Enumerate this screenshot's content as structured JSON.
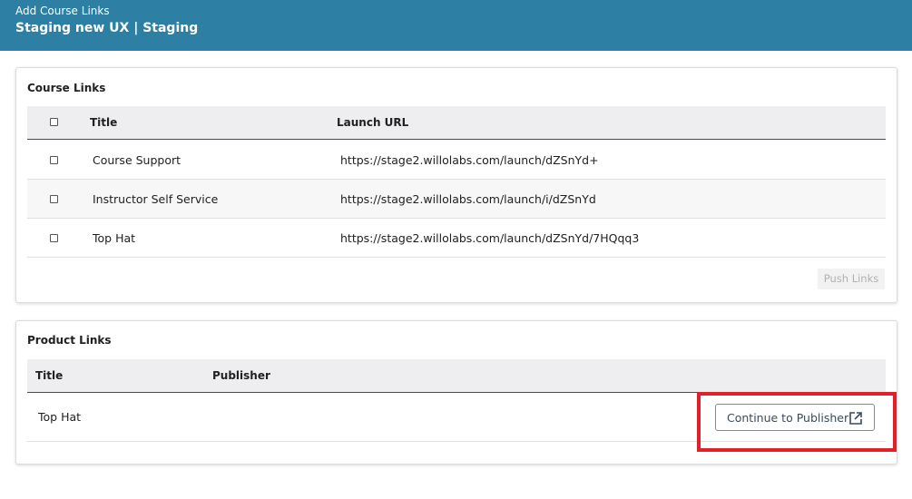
{
  "header": {
    "subtitle": "Add Course Links",
    "title": "Staging new UX | Staging"
  },
  "course_links": {
    "title": "Course Links",
    "columns": {
      "title": "Title",
      "launch_url": "Launch URL"
    },
    "rows": [
      {
        "title": "Course Support",
        "url": "https://stage2.willolabs.com/launch/dZSnYd+"
      },
      {
        "title": "Instructor Self Service",
        "url": "https://stage2.willolabs.com/launch/i/dZSnYd"
      },
      {
        "title": "Top Hat",
        "url": "https://stage2.willolabs.com/launch/dZSnYd/7HQqq3"
      }
    ],
    "push_button": "Push Links"
  },
  "product_links": {
    "title": "Product Links",
    "columns": {
      "title": "Title",
      "publisher": "Publisher"
    },
    "rows": [
      {
        "title": "Top Hat",
        "publisher": ""
      }
    ],
    "continue_button": "Continue to Publisher",
    "continue_icon": "external-link-icon"
  },
  "colors": {
    "header_bg": "#2d7fa3",
    "highlight": "#e0202a"
  }
}
